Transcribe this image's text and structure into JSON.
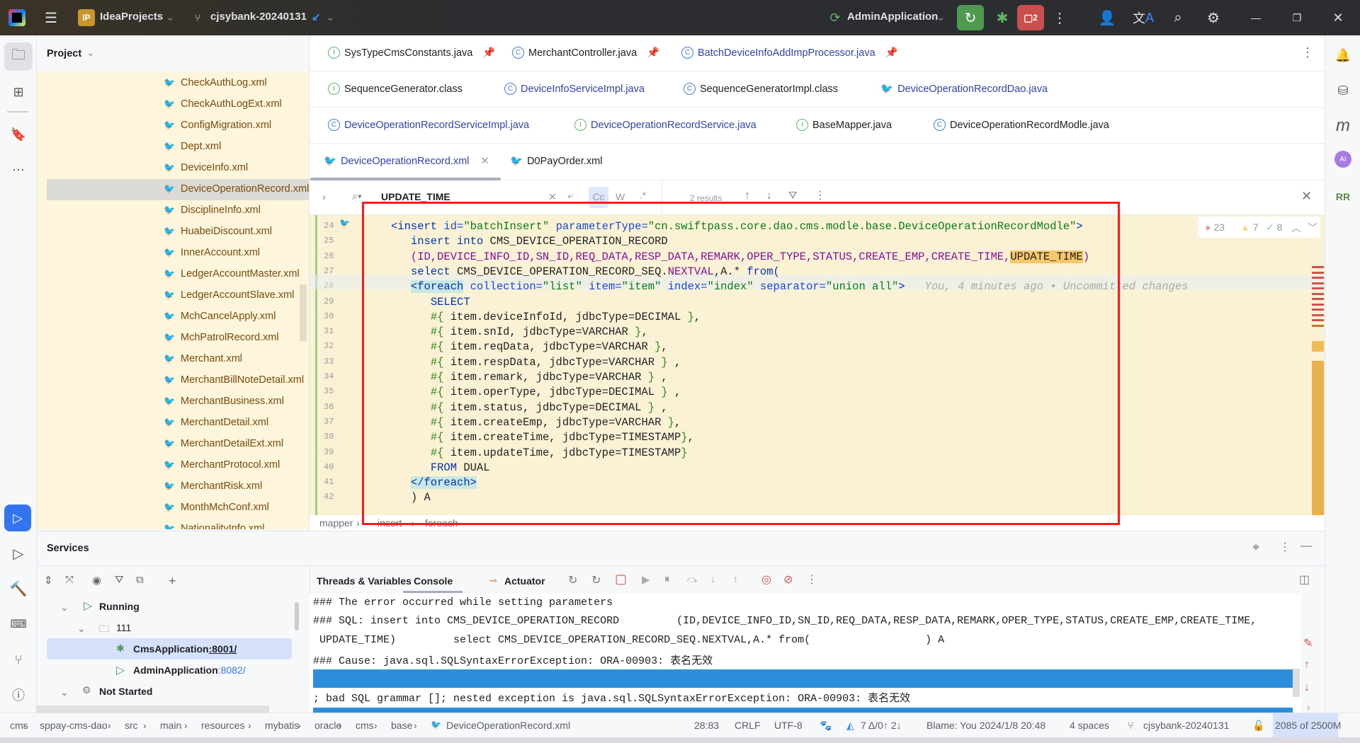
{
  "titlebar": {
    "project_badge": "IP",
    "project": "IdeaProjects",
    "branch": "cjsybank-20240131",
    "run_config": "AdminApplication",
    "run_badge_count": "2"
  },
  "project_panel": {
    "title": "Project",
    "files": [
      "CheckAuthLog.xml",
      "CheckAuthLogExt.xml",
      "ConfigMigration.xml",
      "Dept.xml",
      "DeviceInfo.xml",
      "DeviceOperationRecord.xml",
      "DisciplineInfo.xml",
      "HuabeiDiscount.xml",
      "InnerAccount.xml",
      "LedgerAccountMaster.xml",
      "LedgerAccountSlave.xml",
      "MchCancelApply.xml",
      "MchPatrolRecord.xml",
      "Merchant.xml",
      "MerchantBillNoteDetail.xml",
      "MerchantBusiness.xml",
      "MerchantDetail.xml",
      "MerchantDetailExt.xml",
      "MerchantProtocol.xml",
      "MerchantRisk.xml",
      "MonthMchConf.xml",
      "NationalityInfo.xml"
    ],
    "selected": "DeviceOperationRecord.xml"
  },
  "tabs": {
    "row1": [
      "SysTypeCmsConstants.java",
      "MerchantController.java",
      "BatchDeviceInfoAddImpProcessor.java"
    ],
    "row2": [
      "SequenceGenerator.class",
      "DeviceInfoServiceImpl.java",
      "SequenceGeneratorImpl.class",
      "DeviceOperationRecordDao.java"
    ],
    "row3": [
      "DeviceOperationRecordServiceImpl.java",
      "DeviceOperationRecordService.java",
      "BaseMapper.java",
      "DeviceOperationRecordModle.java"
    ],
    "row4": [
      "DeviceOperationRecord.xml",
      "D0PayOrder.xml"
    ],
    "active": "DeviceOperationRecord.xml"
  },
  "find": {
    "query": "UPDATE_TIME",
    "match_case": "Cc",
    "words": "W",
    "regex": ".*",
    "results": "2 results"
  },
  "inspections": {
    "errors": "23",
    "warnings": "7",
    "typos": "8"
  },
  "code": {
    "line_numbers": [
      "24",
      "25",
      "26",
      "27",
      "28",
      "29",
      "30",
      "31",
      "32",
      "33",
      "34",
      "35",
      "36",
      "37",
      "38",
      "39",
      "40",
      "41",
      "42"
    ],
    "lines": [
      [
        [
          "k",
          "<insert "
        ],
        [
          "a",
          "id="
        ],
        [
          "v",
          "\"batchInsert\" "
        ],
        [
          "a",
          "parameterType="
        ],
        [
          "v",
          "\"cn.swiftpass.core.dao.cms.modle.base.DeviceOperationRecordModle\""
        ],
        [
          "k",
          ">"
        ]
      ],
      [
        [
          "",
          "   "
        ],
        [
          "k",
          "insert into "
        ],
        [
          "",
          "CMS_DEVICE_OPERATION_RECORD"
        ]
      ],
      [
        [
          "",
          "   "
        ],
        [
          "p",
          "(ID,DEVICE_INFO_ID,SN_ID,REQ_DATA,RESP_DATA,REMARK,OPER_TYPE,STATUS,CREATE_EMP,CREATE_TIME,"
        ],
        [
          "hl",
          "UPDATE_TIME"
        ],
        [
          "p",
          ")"
        ]
      ],
      [
        [
          "",
          "   "
        ],
        [
          "k",
          "select "
        ],
        [
          "",
          "CMS_DEVICE_OPERATION_RECORD_SEQ."
        ],
        [
          "p",
          "NEXTVAL"
        ],
        [
          "",
          ",A.* "
        ],
        [
          "k",
          "from("
        ]
      ],
      [
        [
          "",
          "   "
        ],
        [
          "tg",
          "<foreach"
        ],
        [
          "a",
          " collection="
        ],
        [
          "v",
          "\"list\" "
        ],
        [
          "a",
          "item="
        ],
        [
          "v",
          "\"item\" "
        ],
        [
          "a",
          "index="
        ],
        [
          "v",
          "\"index\" "
        ],
        [
          "a",
          "separator="
        ],
        [
          "v",
          "\"union all\""
        ],
        [
          "k",
          ">"
        ],
        [
          "ms",
          "   You, 4 minutes ago • Uncommitted changes"
        ]
      ],
      [
        [
          "",
          "      "
        ],
        [
          "k",
          "SELECT"
        ]
      ],
      [
        [
          "",
          "      "
        ],
        [
          "g",
          "#{ "
        ],
        [
          "",
          "item.deviceInfoId, jdbcType=DECIMAL "
        ],
        [
          "g",
          "}"
        ],
        [
          "",
          ","
        ]
      ],
      [
        [
          "",
          "      "
        ],
        [
          "g",
          "#{ "
        ],
        [
          "",
          "item.snId, jdbcType=VARCHAR "
        ],
        [
          "g",
          "}"
        ],
        [
          "",
          ","
        ]
      ],
      [
        [
          "",
          "      "
        ],
        [
          "g",
          "#{ "
        ],
        [
          "",
          "item.reqData, jdbcType=VARCHAR "
        ],
        [
          "g",
          "}"
        ],
        [
          "",
          ","
        ]
      ],
      [
        [
          "",
          "      "
        ],
        [
          "g",
          "#{ "
        ],
        [
          "",
          "item.respData, jdbcType=VARCHAR "
        ],
        [
          "g",
          "}"
        ],
        [
          "",
          " ,"
        ]
      ],
      [
        [
          "",
          "      "
        ],
        [
          "g",
          "#{ "
        ],
        [
          "",
          "item.remark, jdbcType=VARCHAR "
        ],
        [
          "g",
          "}"
        ],
        [
          "",
          " ,"
        ]
      ],
      [
        [
          "",
          "      "
        ],
        [
          "g",
          "#{ "
        ],
        [
          "",
          "item.operType, jdbcType=DECIMAL "
        ],
        [
          "g",
          "}"
        ],
        [
          "",
          " ,"
        ]
      ],
      [
        [
          "",
          "      "
        ],
        [
          "g",
          "#{ "
        ],
        [
          "",
          "item.status, jdbcType=DECIMAL "
        ],
        [
          "g",
          "}"
        ],
        [
          "",
          " ,"
        ]
      ],
      [
        [
          "",
          "      "
        ],
        [
          "g",
          "#{ "
        ],
        [
          "",
          "item.createEmp, jdbcType=VARCHAR "
        ],
        [
          "g",
          "}"
        ],
        [
          "",
          ","
        ]
      ],
      [
        [
          "",
          "      "
        ],
        [
          "g",
          "#{ "
        ],
        [
          "",
          "item.createTime, jdbcType=TIMESTAMP"
        ],
        [
          "g",
          "}"
        ],
        [
          "",
          ","
        ]
      ],
      [
        [
          "",
          "      "
        ],
        [
          "g",
          "#{ "
        ],
        [
          "",
          "item.updateTime, jdbcType=TIMESTAMP"
        ],
        [
          "g",
          "}"
        ]
      ],
      [
        [
          "",
          "      "
        ],
        [
          "k",
          "FROM "
        ],
        [
          "",
          "DUAL"
        ]
      ],
      [
        [
          "",
          "   "
        ],
        [
          "tg",
          "</foreach>"
        ]
      ],
      [
        [
          "",
          "   ) A"
        ]
      ]
    ]
  },
  "breadcrumb": [
    "mapper",
    "insert",
    "foreach"
  ],
  "services": {
    "title": "Services",
    "tree": [
      {
        "label": "Running",
        "port": ""
      },
      {
        "label": "111",
        "port": ""
      },
      {
        "label": "CmsApplication",
        "port": ":8001/"
      },
      {
        "label": "AdminApplication",
        "port": ":8082/"
      },
      {
        "label": "Not Started",
        "port": ""
      }
    ],
    "tabs": [
      "Threads & Variables",
      "Console",
      "Actuator"
    ],
    "active_tab": "Console",
    "console": [
      "### The error occurred while setting parameters",
      "### SQL: insert into CMS_DEVICE_OPERATION_RECORD         (ID,DEVICE_INFO_ID,SN_ID,REQ_DATA,RESP_DATA,REMARK,OPER_TYPE,STATUS,CREATE_EMP,CREATE_TIME,",
      " UPDATE_TIME)         select CMS_DEVICE_OPERATION_RECORD_SEQ.NEXTVAL,A.* from(                  ) A",
      "### Cause: java.sql.SQLSyntaxErrorException: ORA-00903: 表名无效",
      "; bad SQL grammar []; nested exception is java.sql.SQLSyntaxErrorException: ORA-00903: 表名无效"
    ]
  },
  "statusbar": {
    "path": [
      "cms",
      "sppay-cms-dao",
      "src",
      "main",
      "resources",
      "mybatis",
      "oracle",
      "cms",
      "base",
      "DeviceOperationRecord.xml"
    ],
    "position": "28:83",
    "line_sep": "CRLF",
    "encoding": "UTF-8",
    "vcs_changes": "7 Δ/0↑ 2↓",
    "blame": "Blame: You 2024/1/8 20:48",
    "indent": "4 spaces",
    "branch": "cjsybank-20240131",
    "memory": "2085 of 2500M"
  },
  "colors": {
    "accent": "#3574f0",
    "highlight_box": "#ff1a1a",
    "editor_bg": "#fbf2d6",
    "error": "#db5c5c"
  }
}
